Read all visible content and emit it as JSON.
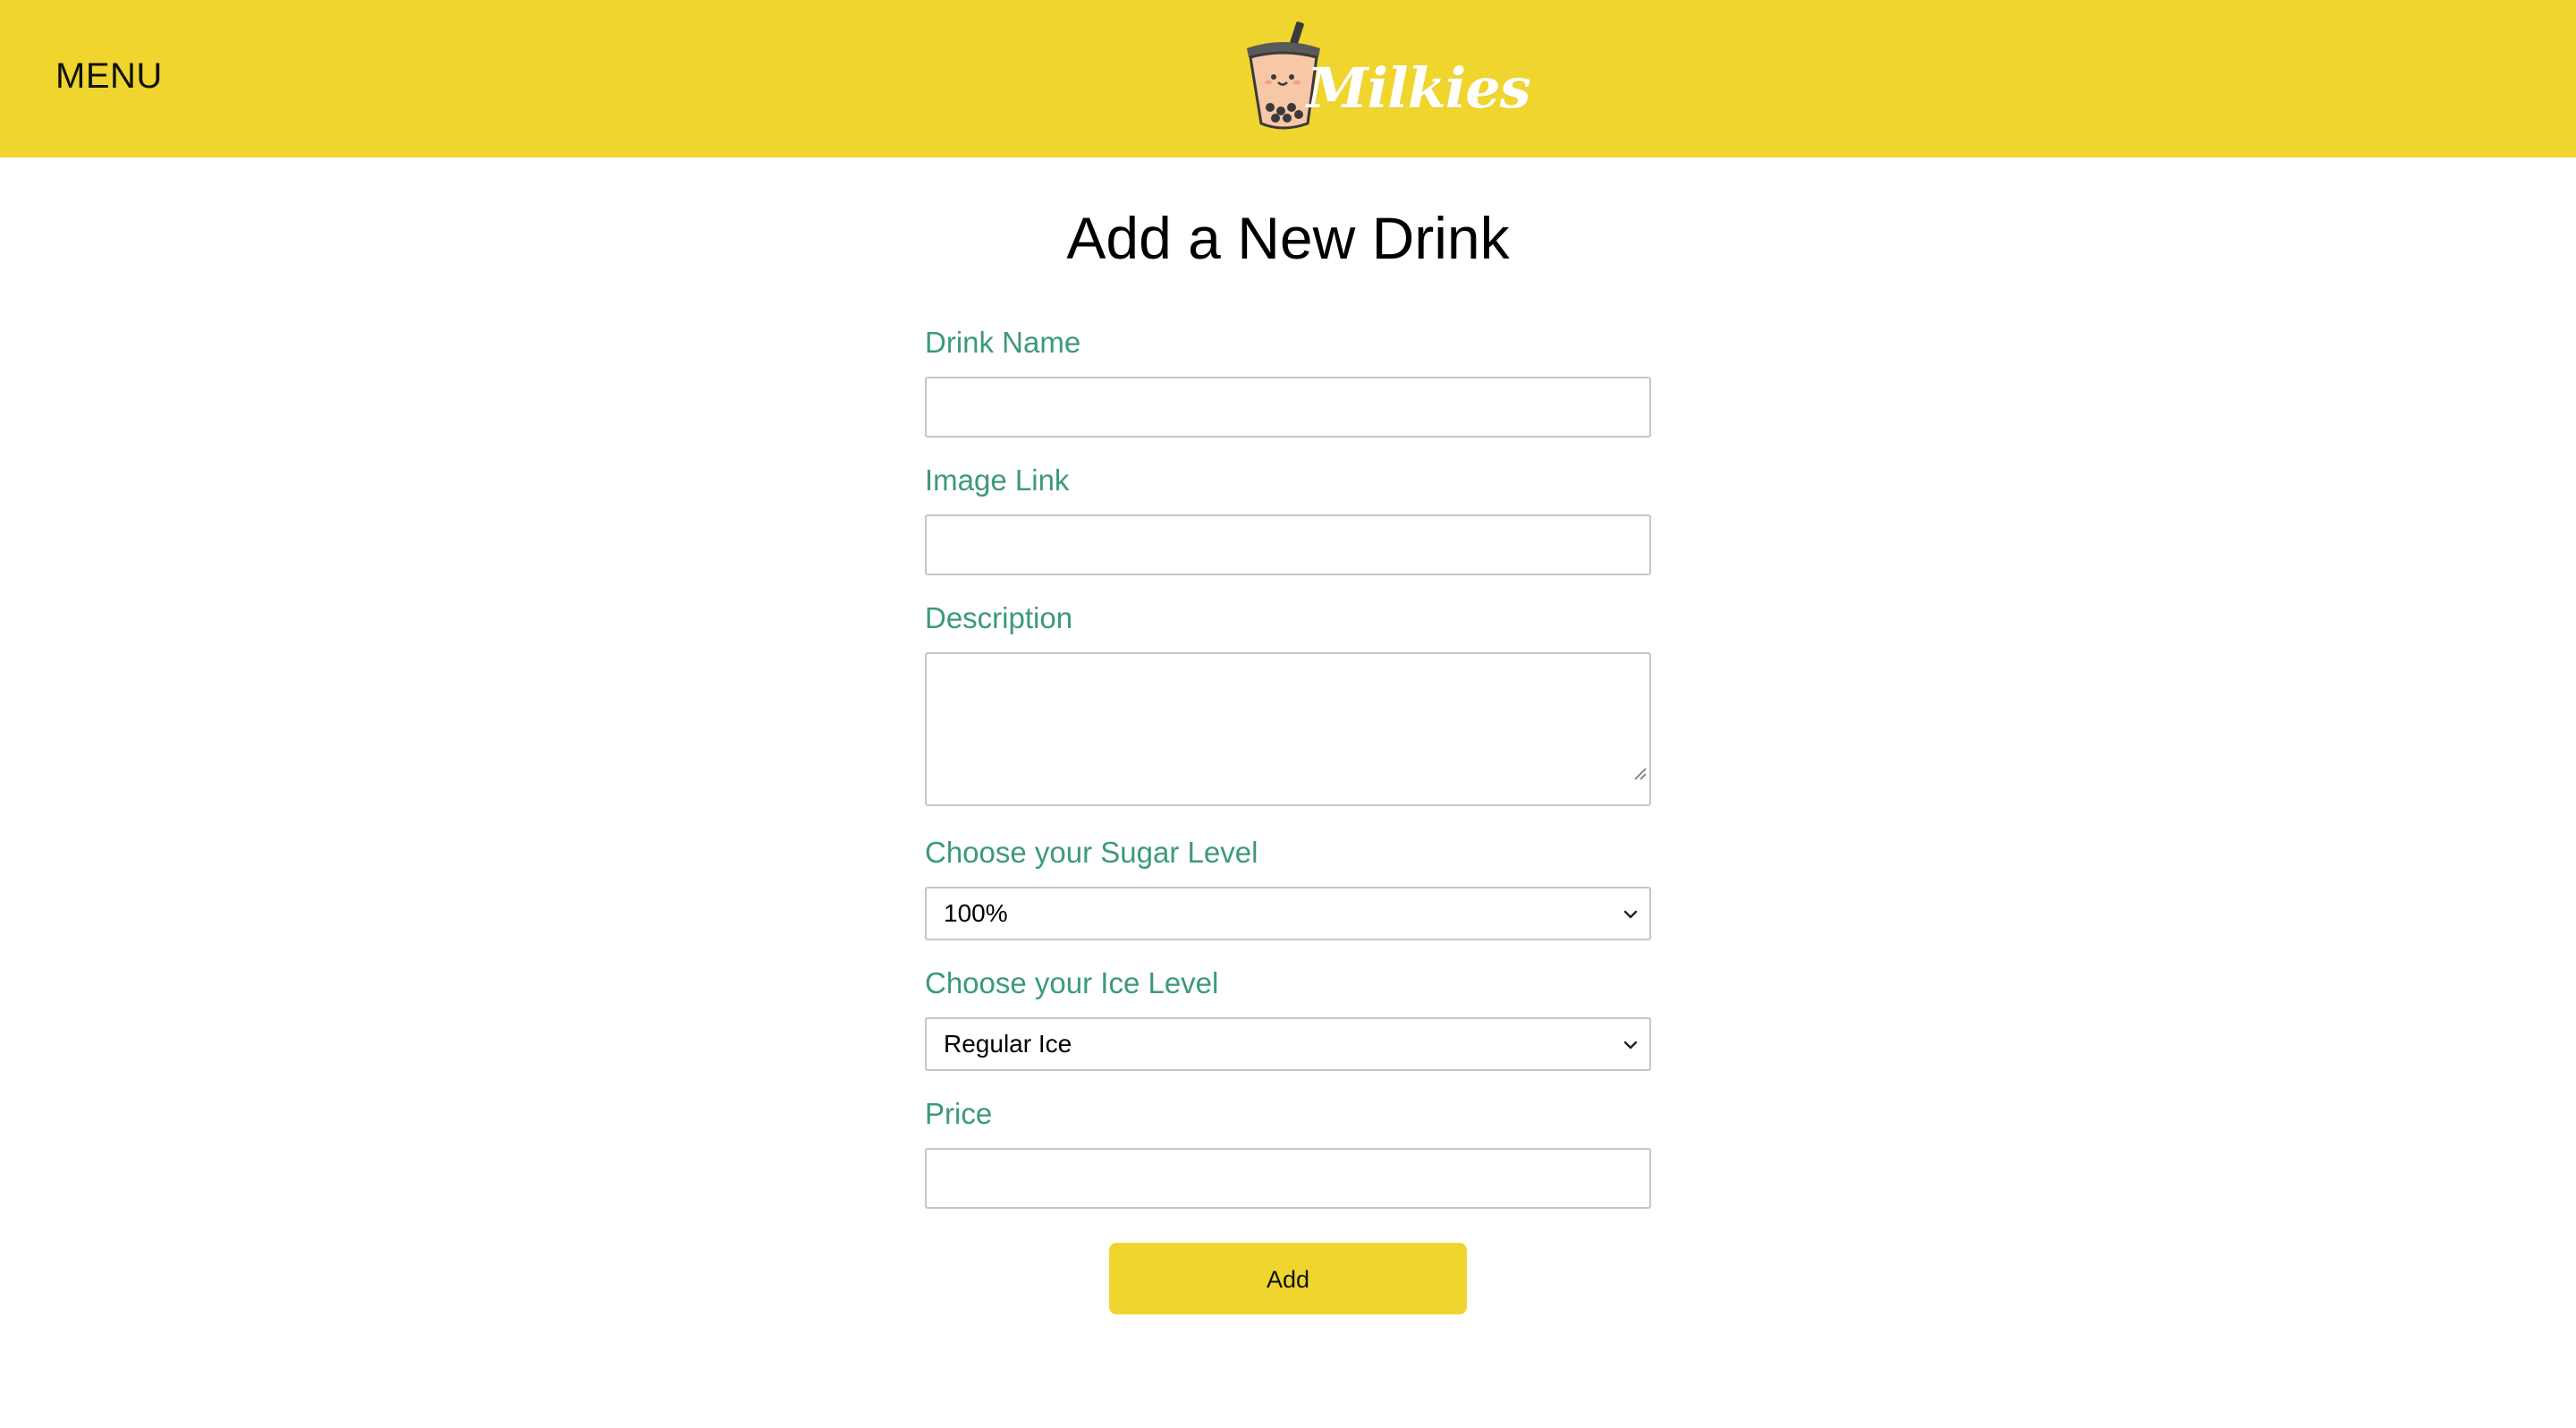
{
  "header": {
    "menu_label": "MENU",
    "brand_name": "Milkies",
    "background_color": "#efd52d"
  },
  "page": {
    "title": "Add a New Drink"
  },
  "form": {
    "label_color": "#3c9a78",
    "drink_name": {
      "label": "Drink Name",
      "value": ""
    },
    "image_link": {
      "label": "Image Link",
      "value": ""
    },
    "description": {
      "label": "Description",
      "value": ""
    },
    "sugar_level": {
      "label": "Choose your Sugar Level",
      "selected": "100%"
    },
    "ice_level": {
      "label": "Choose your Ice Level",
      "selected": "Regular Ice"
    },
    "price": {
      "label": "Price",
      "value": ""
    },
    "submit_label": "Add"
  },
  "icons": {
    "logo": "boba-cup-icon",
    "select_arrow": "chevron-down-icon",
    "resize": "resize-grip-icon"
  }
}
